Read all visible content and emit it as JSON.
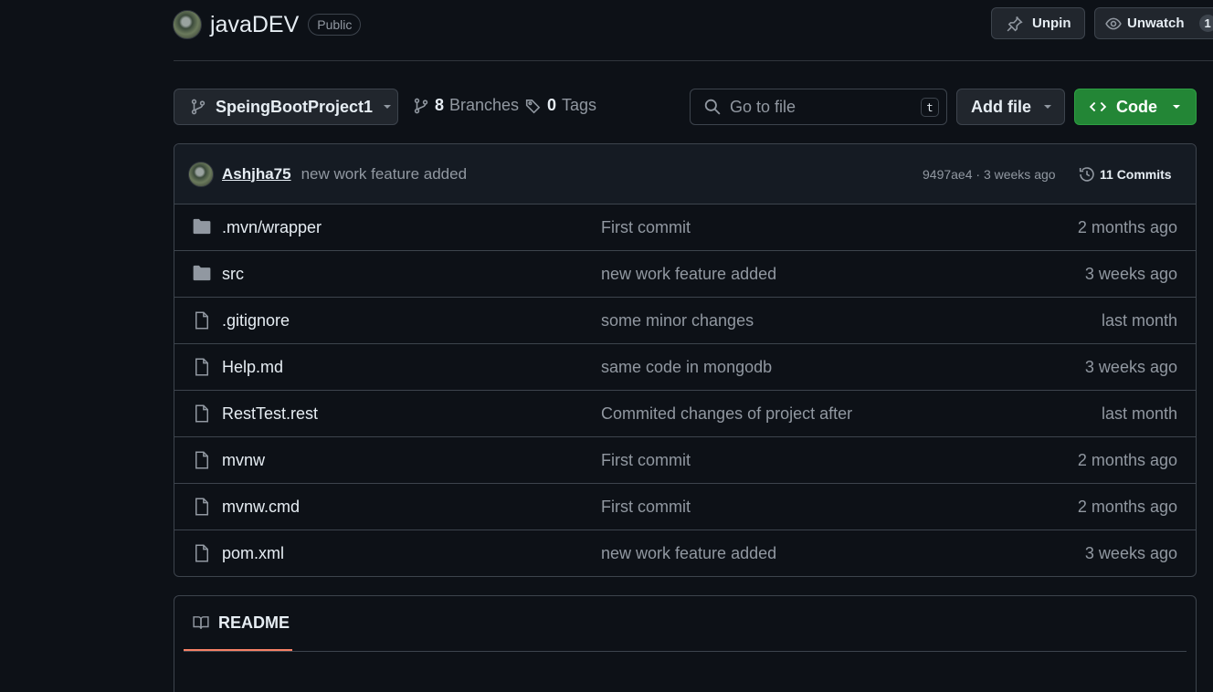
{
  "repo": {
    "name": "javaDEV",
    "visibility": "Public"
  },
  "header_actions": {
    "unpin_label": "Unpin",
    "unwatch_label": "Unwatch",
    "watch_count": "1"
  },
  "toolbar": {
    "branch": "SpeingBootProject1",
    "branches_count": "8",
    "branches_label": "Branches",
    "tags_count": "0",
    "tags_label": "Tags",
    "search_placeholder": "Go to file",
    "search_shortcut": "t",
    "add_file_label": "Add file",
    "code_label": "Code"
  },
  "latest_commit": {
    "author": "Ashjha75",
    "message": "new work feature added",
    "meta": "9497ae4 · 3 weeks ago",
    "commits_label": "11 Commits"
  },
  "files": [
    {
      "icon": "folder-icon",
      "name": ".mvn/wrapper",
      "commit": "First commit",
      "age": "2 months ago"
    },
    {
      "icon": "folder-icon",
      "name": "src",
      "commit": "new work feature added",
      "age": "3 weeks ago"
    },
    {
      "icon": "file-icon",
      "name": ".gitignore",
      "commit": "some minor changes",
      "age": "last month"
    },
    {
      "icon": "file-icon",
      "name": "Help.md",
      "commit": "same code in mongodb",
      "age": "3 weeks ago"
    },
    {
      "icon": "file-icon",
      "name": "RestTest.rest",
      "commit": "Commited changes of project after",
      "age": "last month"
    },
    {
      "icon": "file-icon",
      "name": "mvnw",
      "commit": "First commit",
      "age": "2 months ago"
    },
    {
      "icon": "file-icon",
      "name": "mvnw.cmd",
      "commit": "First commit",
      "age": "2 months ago"
    },
    {
      "icon": "file-icon",
      "name": "pom.xml",
      "commit": "new work feature added",
      "age": "3 weeks ago"
    }
  ],
  "readme": {
    "tab_label": "README"
  },
  "colors": {
    "background": "#0d1117",
    "border": "#3d444d",
    "primary_button": "#238636",
    "muted_text": "#9198a1",
    "tab_underline": "#f78166"
  }
}
